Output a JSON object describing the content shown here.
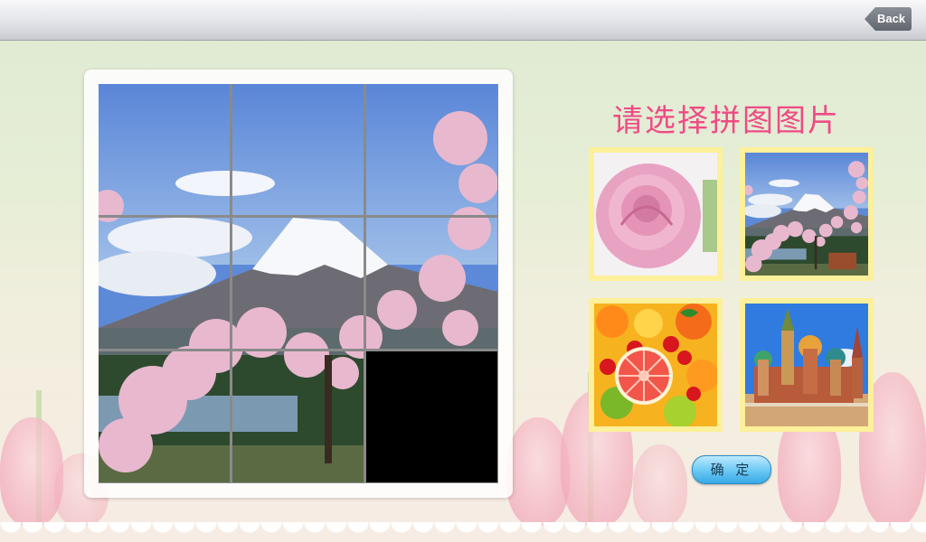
{
  "header": {
    "back_label": "Back"
  },
  "puzzle": {
    "grid_size": 3,
    "empty_tile_index": 8,
    "tiles": [
      "tile-1",
      "tile-2",
      "tile-3",
      "tile-4",
      "tile-5",
      "tile-6",
      "tile-7",
      "tile-8",
      "empty"
    ],
    "image": "mount-fuji-cherry-blossoms"
  },
  "picker": {
    "title": "请选择拼图图片",
    "options": [
      {
        "name": "pink-rose"
      },
      {
        "name": "mount-fuji-cherry-blossoms"
      },
      {
        "name": "fruits-grapefruit"
      },
      {
        "name": "st-basils-cathedral"
      }
    ],
    "confirm_label": "确 定"
  },
  "colors": {
    "title": "#ee4b84",
    "thumb_border": "#fdf09a",
    "confirm": "#6fcaf5"
  }
}
